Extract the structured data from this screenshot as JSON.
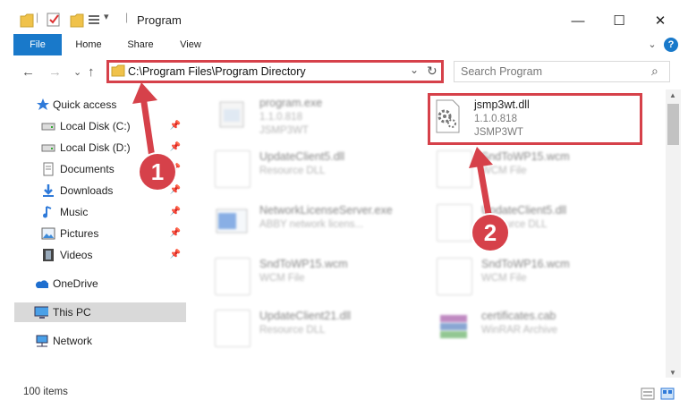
{
  "window": {
    "title": "Program",
    "qa_separator": "|",
    "qa_dropdown": "▾",
    "minimize": "—",
    "maximize": "☐",
    "close": "✕"
  },
  "ribbon": {
    "tabs": [
      "File",
      "Home",
      "Share",
      "View"
    ],
    "expand": "⌄",
    "help": "?"
  },
  "nav": {
    "back": "←",
    "forward": "→",
    "recent": "⌄",
    "up": "↑"
  },
  "address": {
    "path": "C:\\Program Files\\Program Directory",
    "dropdown": "⌄",
    "refresh": "↻"
  },
  "search": {
    "placeholder": "Search Program",
    "icon": "⌕"
  },
  "sidebar": {
    "items": [
      {
        "label": "Quick access",
        "icon": "star-icon"
      },
      {
        "label": "Local Disk (C:)",
        "icon": "drive-icon"
      },
      {
        "label": "Local Disk (D:)",
        "icon": "drive-icon"
      },
      {
        "label": "Documents",
        "icon": "documents-icon"
      },
      {
        "label": "Downloads",
        "icon": "download-arrow-icon"
      },
      {
        "label": "Music",
        "icon": "music-note-icon"
      },
      {
        "label": "Pictures",
        "icon": "pictures-icon"
      },
      {
        "label": "Videos",
        "icon": "film-icon"
      },
      {
        "label": "OneDrive",
        "icon": "cloud-icon"
      },
      {
        "label": "This PC",
        "icon": "computer-icon"
      },
      {
        "label": "Network",
        "icon": "network-icon"
      }
    ],
    "pin_glyph": "📌"
  },
  "files": [
    {
      "name": "program.exe",
      "line1": "1.1.0.818",
      "line2": "JSMP3WT",
      "icon": "program-icon"
    },
    {
      "name": "jsmp3wt.dll",
      "line1": "1.1.0.818",
      "line2": "JSMP3WT",
      "icon": "dll-gear-icon"
    },
    {
      "name": "UpdateClient5.dll",
      "line1": "Resource DLL",
      "line2": "",
      "icon": "dll-gear-icon"
    },
    {
      "name": "SndToWP15.wcm",
      "line1": "WCM File",
      "line2": "",
      "icon": "generic-file-icon"
    },
    {
      "name": "NetworkLicenseServer.exe",
      "line1": "ABBY network licens...",
      "line2": "",
      "icon": "app-window-icon"
    },
    {
      "name": "UpdateClient5.dll",
      "line1": "Resource DLL",
      "line2": "",
      "icon": "dll-gear-icon"
    },
    {
      "name": "SndToWP15.wcm",
      "line1": "WCM File",
      "line2": "",
      "icon": "generic-file-icon"
    },
    {
      "name": "SndToWP16.wcm",
      "line1": "WCM File",
      "line2": "",
      "icon": "generic-file-icon"
    },
    {
      "name": "UpdateClient21.dll",
      "line1": "Resource DLL",
      "line2": "",
      "icon": "dll-gear-icon"
    },
    {
      "name": "certificates.cab",
      "line1": "WinRAR Archive",
      "line2": "",
      "icon": "winrar-icon"
    }
  ],
  "status": {
    "count": "100 items"
  },
  "annotations": {
    "one": "1",
    "two": "2"
  },
  "colors": {
    "accent": "#1979ca",
    "annotation": "#d6414a",
    "selection": "#d9d9d9"
  }
}
